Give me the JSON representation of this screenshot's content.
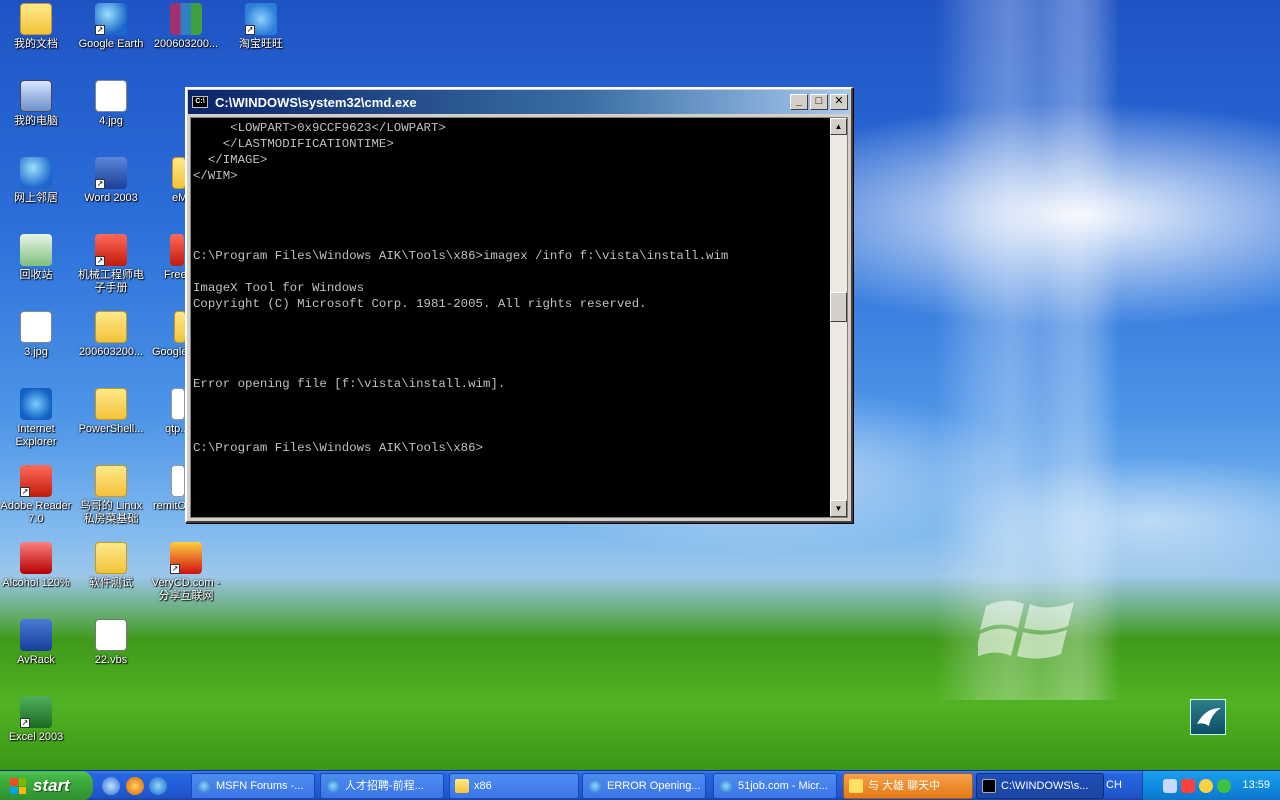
{
  "desktop": {
    "icons": [
      {
        "label": "我的文档"
      },
      {
        "label": "Google Earth"
      },
      {
        "label": "200603200..."
      },
      {
        "label": "淘宝旺旺"
      },
      {
        "label": "我的电脑"
      },
      {
        "label": "4.jpg"
      },
      {
        "label": "网上邻居"
      },
      {
        "label": "Word 2003"
      },
      {
        "label": "eM..."
      },
      {
        "label": "回收站"
      },
      {
        "label": "机械工程师电子手册"
      },
      {
        "label": "Free..."
      },
      {
        "label": "3.jpg"
      },
      {
        "label": "200603200..."
      },
      {
        "label": "Google..."
      },
      {
        "label": "Internet Explorer"
      },
      {
        "label": "PowerShell..."
      },
      {
        "label": "qtp..."
      },
      {
        "label": "Adobe Reader 7.0"
      },
      {
        "label": "鸟哥的 Linux 私房菜基础"
      },
      {
        "label": "remitO..."
      },
      {
        "label": "Alcohol 120%"
      },
      {
        "label": "软件测试"
      },
      {
        "label": "VeryCD.com - 分享互联网"
      },
      {
        "label": "AvRack"
      },
      {
        "label": "22.vbs"
      },
      {
        "label": "Excel 2003"
      }
    ]
  },
  "cmd": {
    "title": "C:\\WINDOWS\\system32\\cmd.exe",
    "icon_text": "C:\\",
    "minimize": "_",
    "maximize": "□",
    "close": "✕",
    "output": "     <LOWPART>0x9CCF9623</LOWPART>\n    </LASTMODIFICATIONTIME>\n  </IMAGE>\n</WIM>\n\n\n\n\nC:\\Program Files\\Windows AIK\\Tools\\x86>imagex /info f:\\vista\\install.wim\n\nImageX Tool for Windows\nCopyright (C) Microsoft Corp. 1981-2005. All rights reserved.\n\n\n\n\nError opening file [f:\\vista\\install.wim].\n\n\n\nC:\\Program Files\\Windows AIK\\Tools\\x86>",
    "scroll_up": "▲",
    "scroll_down": "▼"
  },
  "taskbar": {
    "start_label": "start",
    "buttons": [
      {
        "label": "MSFN Forums -..."
      },
      {
        "label": "人才招聘-前程..."
      },
      {
        "label": "x86"
      },
      {
        "label": "ERROR Opening..."
      },
      {
        "label": "51job.com - Micr..."
      },
      {
        "label": "与 大雄 聊天中"
      },
      {
        "label": "C:\\WINDOWS\\s..."
      }
    ],
    "language": "CH",
    "tray_arrow": "‹",
    "clock": "13:59"
  }
}
